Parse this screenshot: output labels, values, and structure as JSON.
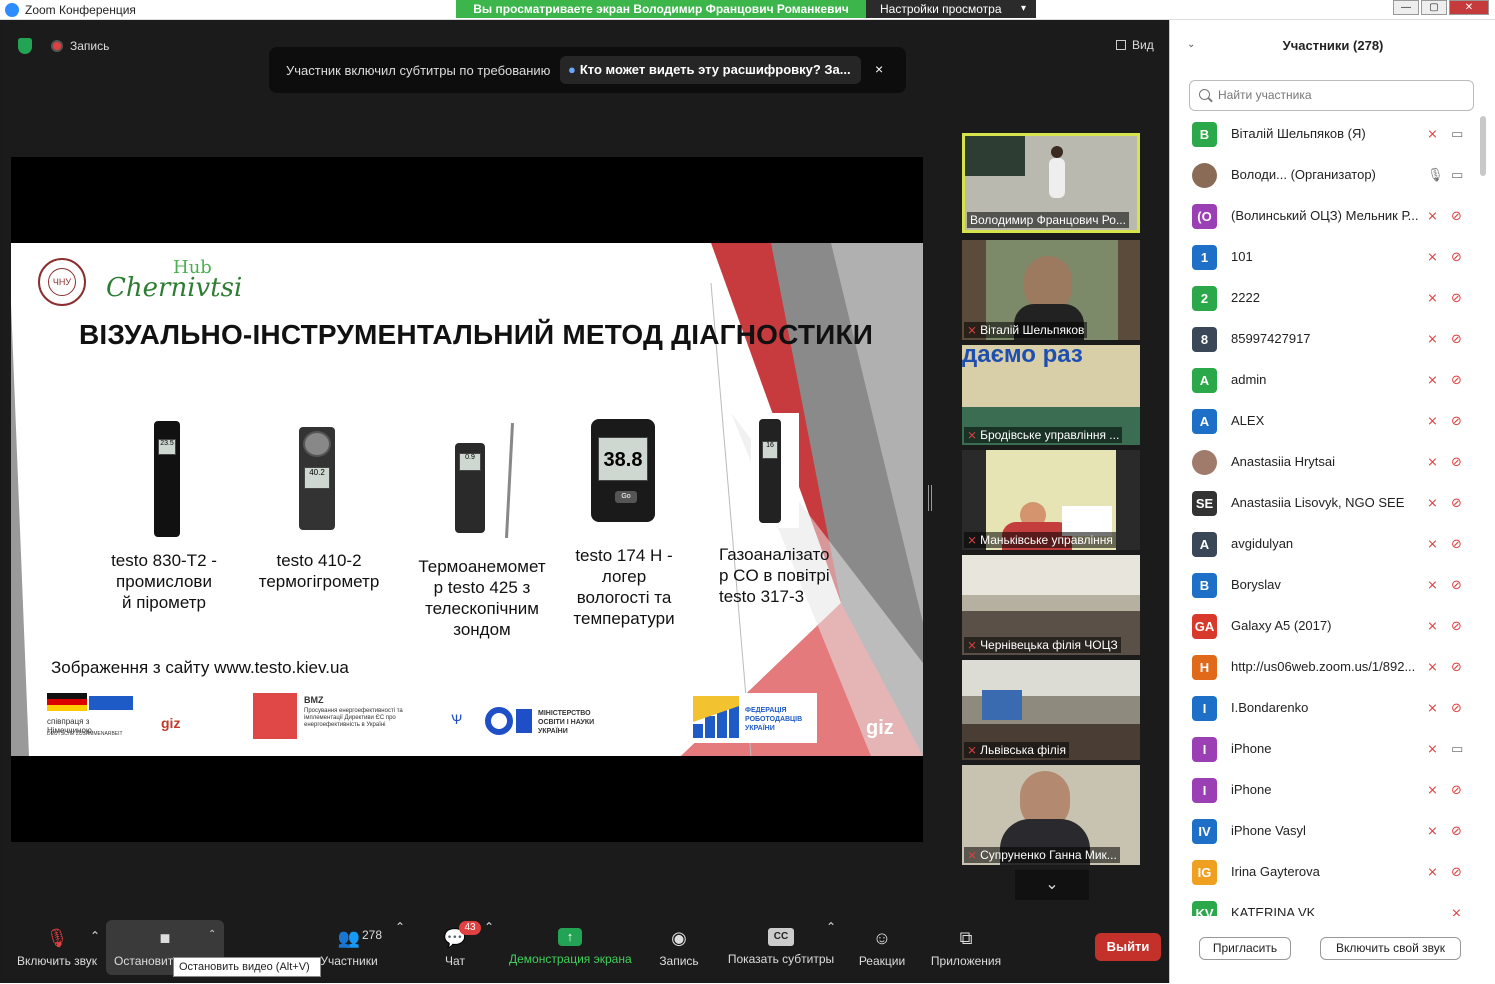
{
  "window": {
    "title": "Zoom Конференция",
    "banner": "Вы просматриваете экран Володимир Францович Романкевич",
    "view_options": "Настройки просмотра"
  },
  "meeting": {
    "record_label": "Запись",
    "view_label": "Вид",
    "toast": {
      "message": "Участник включил субтитры по требованию",
      "link": "Кто может видеть эту расшифровку? За...",
      "close": "×"
    }
  },
  "slide": {
    "hub_top": "Hub",
    "hub_name": "Chernivtsi",
    "logo_text": "ЧНУ",
    "title": "ВІЗУАЛЬНО-ІНСТРУМЕНТАЛЬНИЙ МЕТОД ДІАГНОСТИКИ",
    "devices": [
      {
        "l1": "testo 830-T2 -",
        "l2": "промислови",
        "l3": "й пірометр",
        "l4": ""
      },
      {
        "l1": "testo 410-2",
        "l2": "термогігрометр",
        "l3": "",
        "l4": ""
      },
      {
        "l1": "Термоанемомет",
        "l2": "р testo 425 з",
        "l3": "телескопічним",
        "l4": "зондом"
      },
      {
        "l1": "testo 174 H -",
        "l2": "логер",
        "l3": "вологості та",
        "l4": "температури"
      },
      {
        "l1": "Газоаналізато",
        "l2": "р  CO  в  повітрі",
        "l3": "testo 317-3",
        "l4": ""
      }
    ],
    "device_readouts": [
      "23.5",
      "40.2",
      "0.9",
      "38.8",
      "16"
    ],
    "credit": "Зображення з сайту www.testo.kiev.ua",
    "footer": {
      "de": "співпраця з Німеччиною",
      "de_sub": "DEUTSCHE ZUSAMMENARBEIT",
      "giz": "giz",
      "bmz": "BMZ",
      "bmz_text": "Просування енергоефективності та імплементації Директиви ЄС про енергоефективність в Україні",
      "mon": "МІНІСТЕРСТВО ОСВІТИ І НАУКИ УКРАЇНИ",
      "fed": "ФЕДЕРАЦІЯ РОБОТОДАВЦІВ УКРАЇНИ",
      "giz_right": "giz"
    }
  },
  "videos": [
    {
      "name": "Володимир Францович Ро...",
      "muted": false,
      "active": true
    },
    {
      "name": "Віталій Шельпяков",
      "muted": true,
      "active": false
    },
    {
      "name": "Бродівське управління ...",
      "muted": true,
      "active": false
    },
    {
      "name": "Маньківське управління",
      "muted": true,
      "active": false
    },
    {
      "name": "Чернівецька філія ЧОЦЗ",
      "muted": true,
      "active": false
    },
    {
      "name": "Львівська філія",
      "muted": true,
      "active": false
    },
    {
      "name": "Супруненко Ганна Мик...",
      "muted": true,
      "active": false
    }
  ],
  "toolbar": {
    "unmute": "Включить звук",
    "stop_video": "Остановить видео",
    "participants": "Участники",
    "participants_count": "278",
    "chat": "Чат",
    "chat_badge": "43",
    "share": "Демонстрация экрана",
    "record": "Запись",
    "captions": "Показать субтитры",
    "reactions": "Реакции",
    "apps": "Приложения",
    "leave": "Выйти",
    "tooltip": "Остановить видео (Alt+V)"
  },
  "panel": {
    "title": "Участники (278)",
    "search_placeholder": "Найти участника",
    "invite": "Пригласить",
    "unmute_me": "Включить свой звук",
    "participants": [
      {
        "initials": "В",
        "color": "#2ba84a",
        "name": "Віталій Шельпяков (Я)",
        "mic": "off",
        "cam": "on"
      },
      {
        "initials": "",
        "color": "#8a6b55",
        "name": "Володи... (Организатор)",
        "mic": "on",
        "cam": "on"
      },
      {
        "initials": "(О",
        "color": "#9b3fb5",
        "name": "(Волинський ОЦЗ) Мельник Р...",
        "mic": "off",
        "cam": "off"
      },
      {
        "initials": "1",
        "color": "#1e6fc8",
        "name": "101",
        "mic": "off",
        "cam": "off"
      },
      {
        "initials": "2",
        "color": "#2ba84a",
        "name": "2222",
        "mic": "off",
        "cam": "off"
      },
      {
        "initials": "8",
        "color": "#3a4756",
        "name": "85997427917",
        "mic": "off",
        "cam": "off"
      },
      {
        "initials": "A",
        "color": "#2ba84a",
        "name": "admin",
        "mic": "off",
        "cam": "off"
      },
      {
        "initials": "A",
        "color": "#1e6fc8",
        "name": "ALEX",
        "mic": "off",
        "cam": "off"
      },
      {
        "initials": "",
        "color": "#a07a6a",
        "name": "Anastasiia Hrytsai",
        "mic": "off",
        "cam": "off"
      },
      {
        "initials": "SE",
        "color": "#333333",
        "name": "Anastasiia Lisovyk, NGO SEE",
        "mic": "off",
        "cam": "off"
      },
      {
        "initials": "A",
        "color": "#3a4756",
        "name": "avgidulyan",
        "mic": "off",
        "cam": "off"
      },
      {
        "initials": "B",
        "color": "#1e6fc8",
        "name": "Boryslav",
        "mic": "off",
        "cam": "off"
      },
      {
        "initials": "GA",
        "color": "#d8392b",
        "name": "Galaxy A5 (2017)",
        "mic": "off",
        "cam": "off"
      },
      {
        "initials": "H",
        "color": "#e0691a",
        "name": "http://us06web.zoom.us/1/892...",
        "mic": "off",
        "cam": "off"
      },
      {
        "initials": "I",
        "color": "#1e6fc8",
        "name": "I.Bondarenko",
        "mic": "off",
        "cam": "off"
      },
      {
        "initials": "I",
        "color": "#9b3fb5",
        "name": "iPhone",
        "mic": "off",
        "cam": "on"
      },
      {
        "initials": "I",
        "color": "#9b3fb5",
        "name": "iPhone",
        "mic": "off",
        "cam": "off"
      },
      {
        "initials": "IV",
        "color": "#1e6fc8",
        "name": "iPhone Vasyl",
        "mic": "off",
        "cam": "off"
      },
      {
        "initials": "IG",
        "color": "#f0a020",
        "name": "Irina Gayterova",
        "mic": "off",
        "cam": "off"
      },
      {
        "initials": "KV",
        "color": "#2ba84a",
        "name": "KATERINA VK",
        "mic": "off",
        "cam": "none"
      }
    ]
  }
}
